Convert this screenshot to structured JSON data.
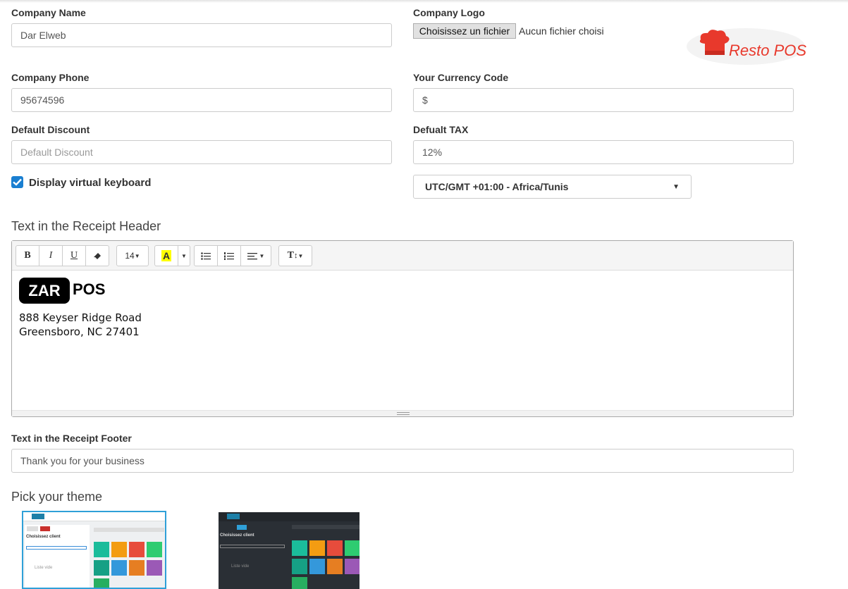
{
  "company_name": {
    "label": "Company Name",
    "value": "Dar Elweb"
  },
  "company_logo": {
    "label": "Company Logo",
    "button": "Choisissez un fichier",
    "status": "Aucun fichier choisi",
    "logo_text": "Resto POS"
  },
  "company_phone": {
    "label": "Company Phone",
    "value": "95674596"
  },
  "currency": {
    "label": "Your Currency Code",
    "value": "$"
  },
  "discount": {
    "label": "Default Discount",
    "value": "",
    "placeholder": "Default Discount"
  },
  "tax": {
    "label": "Defualt TAX",
    "value": "12%"
  },
  "keyboard": {
    "label": "Display virtual keyboard",
    "checked": true
  },
  "timezone": {
    "selected": "UTC/GMT +01:00 - Africa/Tunis"
  },
  "receipt_header": {
    "title": "Text in the Receipt Header",
    "toolbar": {
      "bold": "B",
      "italic": "I",
      "underline": "U",
      "font_size": "14",
      "color": "A",
      "text_height": "T"
    },
    "content": {
      "logo_left": "ZAR",
      "logo_right": "POS",
      "line1": "888 Keyser Ridge Road",
      "line2": "Greensboro, NC 27401"
    }
  },
  "receipt_footer": {
    "label": "Text in the Receipt Footer",
    "value": "Thank you for your business"
  },
  "theme": {
    "title": "Pick your theme",
    "light": {
      "client": "Choisissez client",
      "empty": "Liste vide"
    },
    "dark": {
      "client": "Choisissez client",
      "empty": "Liste vide"
    }
  },
  "colors": {
    "accent": "#1a7fd1",
    "logo_red": "#e8392c",
    "theme_selected": "#2fa0d8",
    "dark_bg": "#2a2f35"
  }
}
